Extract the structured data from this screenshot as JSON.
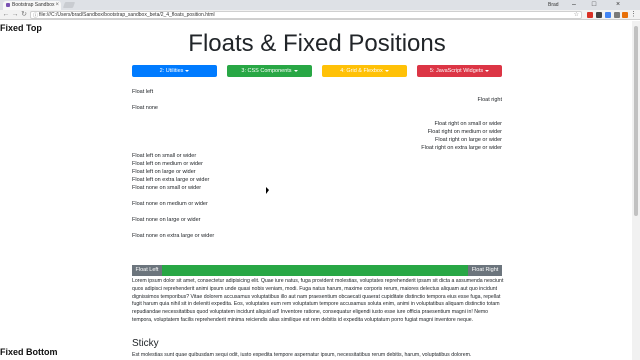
{
  "browser": {
    "tab_title": "Bootstrap Sandbox",
    "tab_close": "×",
    "url": "file:///C:/Users/brad/Sandbox/bootstrap_sandbox_beta/2_4_floats_position.html",
    "user": "Brad",
    "icons": {
      "back": "back-arrow-icon",
      "forward": "forward-arrow-icon",
      "reload": "reload-icon",
      "bookmark": "star-icon",
      "menu": "menu-dots-icon"
    },
    "window_buttons": {
      "minimize": "–",
      "maximize": "□",
      "close": "×"
    },
    "nav_glyphs": {
      "back": "←",
      "forward": "→",
      "reload": "↻",
      "info": "ⓘ",
      "star": "☆",
      "menu": "⋮"
    }
  },
  "page": {
    "fixed_top": "Fixed Top",
    "fixed_bottom": "Fixed Bottom",
    "title": "Floats & Fixed Positions",
    "dropdowns": [
      {
        "label": "2: Utilities",
        "color": "#007bff"
      },
      {
        "label": "3: CSS Components",
        "color": "#28a745"
      },
      {
        "label": "4: Grid & Flexbox",
        "color": "#ffc107"
      },
      {
        "label": "5: JavaScript Widgets",
        "color": "#dc3545"
      }
    ],
    "float_left": "Float left",
    "float_right": "Float right",
    "float_none": "Float none",
    "right_responsive": [
      "Float right on small or wider",
      "Float right on medium or wider",
      "Float right on large or wider",
      "Float right on extra large or wider"
    ],
    "left_responsive": [
      "Float left on small or wider",
      "Float left on medium or wider",
      "Float left on large or wider",
      "Float left on extra large or wider",
      "Float none on small or wider"
    ],
    "none_medium": "Float none on medium or wider",
    "none_large": "Float none on large or wider",
    "none_xlarge": "Float none on extra large or wider",
    "bar": {
      "left": "Float Left",
      "right": "Float Right",
      "color": "#28a745",
      "side_color": "#6c757d"
    },
    "lorem": "Lorem ipsum dolor sit amet, consectetur adipisicing elit. Quae iure natus, fuga provident molestias, voluptates reprehenderit ipsam sit dicta a assumenda nesciunt quos adipisci reprehenderit animi ipsum unde quasi nobis veniam, modi. Fuga natus harum, maxime corporis rerum, maiores delectus aliquam aut quo incidunt dignissimos temporibus? Vitae dolorem accusamus voluptatibus illo aut nam praesentium obcaecati quaerat cupiditate distinctio tempora eius esse fuga, repellat fugit harum quia nihil sit in deleniti expedita. Eos, voluptates eum rem voluptatum tempore accusamus soluta enim, animi in voluptatibus aliquam distinctio totam repudiandae necessitatibus quod voluptatem incidunt aliquid ad! Inventore ratione, consequatur eligendi iusto esse iure officia praesentium magni in! Nemo tempora, voluptatem facilis reprehenderit minima reiciendis alias similique est rem debitis id expedita voluptatum porro fugiat magni inventore neque.",
    "sticky_title": "Sticky",
    "sticky_text": "Est molestias sunt quae quibusdam sequi odit, iusto expedita tempore aspernatur ipsum, necessitatibus rerum debitis, harum, voluptatibus dolorem."
  }
}
